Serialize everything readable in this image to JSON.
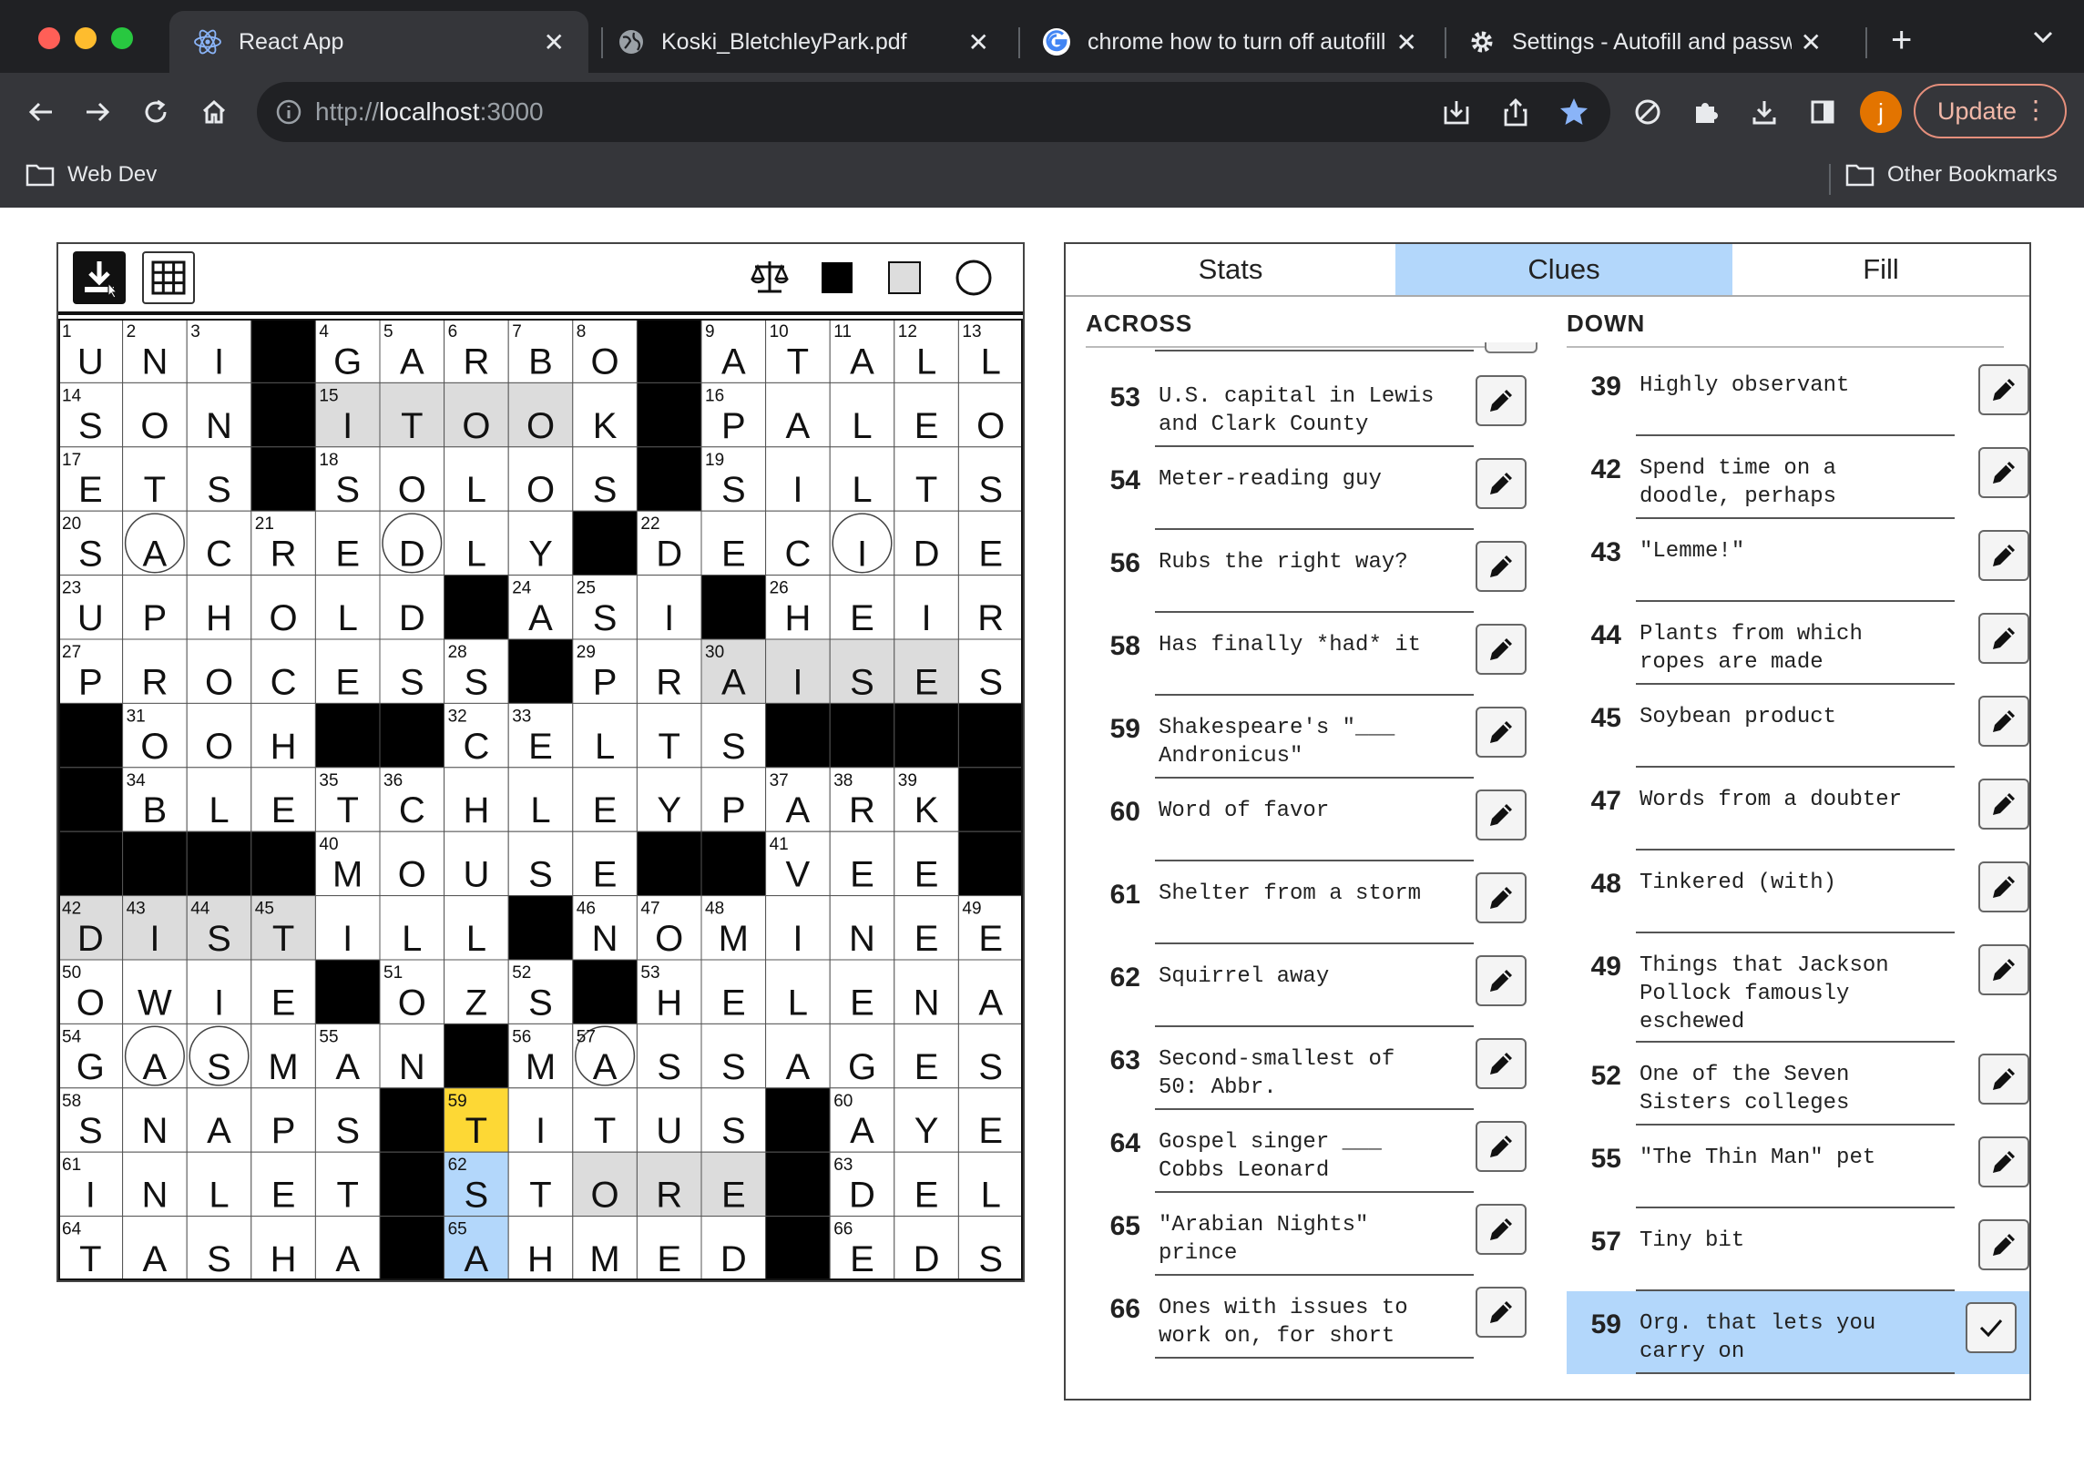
{
  "browser": {
    "tabs": [
      {
        "title": "React App",
        "icon": "react-icon",
        "active": true
      },
      {
        "title": "Koski_BletchleyPark.pdf",
        "icon": "globe-icon",
        "active": false
      },
      {
        "title": "chrome how to turn off autofill",
        "icon": "google-icon",
        "active": false
      },
      {
        "title": "Settings - Autofill and passwords",
        "icon": "gear-icon",
        "active": false
      }
    ],
    "url_prefix": "http://",
    "url_host": "localhost",
    "url_suffix": ":3000",
    "avatar_letter": "j",
    "update_label": "Update",
    "bookmarks": {
      "left": "Web Dev",
      "right": "Other Bookmarks"
    },
    "colors": {
      "accent": "#8ab4f8",
      "update": "#e58f7c",
      "avatar": "#e37400"
    }
  },
  "editor": {
    "tools": [
      "download-icon",
      "grid-icon",
      "scale-icon",
      "black-square-icon",
      "gray-square-icon",
      "circle-icon"
    ],
    "grid": {
      "rows": [
        "UNI#GARBO#ATALL",
        "SON#ITOOK#PALEO",
        "ETS#SOLOS#SILTS",
        "SACREDLY#DECIDE",
        "UPHOLD#ASI#HEIR",
        "PROCESS#PRAISES",
        "#OOH##CELTS####",
        "#BLETCHLEYPARK#",
        "####MOUSE##VEE#",
        "DISTILL#NOMINEE",
        "OWIE#OZS#HELENA",
        "GASMAN#MASSAGES",
        "SNAPS#TITUS#AYE",
        "INLET#STORE#DEL",
        "TASHA#AHMED#EDS"
      ],
      "circles": [
        [
          3,
          1
        ],
        [
          3,
          5
        ],
        [
          3,
          12
        ],
        [
          11,
          1
        ],
        [
          11,
          2
        ],
        [
          11,
          8
        ]
      ],
      "shaded": [
        [
          1,
          4
        ],
        [
          1,
          5
        ],
        [
          1,
          6
        ],
        [
          1,
          7
        ],
        [
          5,
          10
        ],
        [
          5,
          11
        ],
        [
          5,
          12
        ],
        [
          5,
          13
        ],
        [
          9,
          0
        ],
        [
          9,
          1
        ],
        [
          9,
          2
        ],
        [
          9,
          3
        ],
        [
          13,
          8
        ],
        [
          13,
          9
        ],
        [
          13,
          10
        ]
      ],
      "cursor": [
        12,
        6
      ],
      "highlight": [
        [
          13,
          6
        ],
        [
          14,
          6
        ]
      ],
      "colors": {
        "cursor": "#fdd835",
        "highlight": "#b3d7fb",
        "shaded": "#dcdcdc",
        "block": "#000000"
      }
    }
  },
  "panel": {
    "tabs": [
      {
        "label": "Stats",
        "selected": false
      },
      {
        "label": "Clues",
        "selected": true
      },
      {
        "label": "Fill",
        "selected": false
      }
    ],
    "across_title": "ACROSS",
    "down_title": "DOWN",
    "across": [
      {
        "num": "53",
        "text": "U.S. capital in Lewis\nand Clark County"
      },
      {
        "num": "54",
        "text": "Meter-reading guy"
      },
      {
        "num": "56",
        "text": "Rubs the right way?"
      },
      {
        "num": "58",
        "text": "Has finally *had* it"
      },
      {
        "num": "59",
        "text": "Shakespeare's \"___\nAndronicus\"",
        "marker": true
      },
      {
        "num": "60",
        "text": "Word of favor"
      },
      {
        "num": "61",
        "text": "Shelter from a storm"
      },
      {
        "num": "62",
        "text": "Squirrel away"
      },
      {
        "num": "63",
        "text": "Second-smallest of\n50: Abbr."
      },
      {
        "num": "64",
        "text": "Gospel singer ___\nCobbs Leonard"
      },
      {
        "num": "65",
        "text": "\"Arabian Nights\"\nprince"
      },
      {
        "num": "66",
        "text": "Ones with issues to\nwork on, for short"
      }
    ],
    "down": [
      {
        "num": "39",
        "text": "Highly observant"
      },
      {
        "num": "42",
        "text": "Spend time on a\ndoodle, perhaps"
      },
      {
        "num": "43",
        "text": "\"Lemme!\""
      },
      {
        "num": "44",
        "text": "Plants from which\nropes are made"
      },
      {
        "num": "45",
        "text": "Soybean product"
      },
      {
        "num": "47",
        "text": "Words from a doubter"
      },
      {
        "num": "48",
        "text": "Tinkered (with)"
      },
      {
        "num": "49",
        "text": "Things that Jackson\nPollock famously\neschewed",
        "tall": true
      },
      {
        "num": "52",
        "text": "One of the Seven\nSisters colleges"
      },
      {
        "num": "55",
        "text": "\"The Thin Man\" pet"
      },
      {
        "num": "57",
        "text": "Tiny bit"
      },
      {
        "num": "59",
        "text": "Org. that lets you\ncarry on",
        "selected": true
      }
    ]
  }
}
